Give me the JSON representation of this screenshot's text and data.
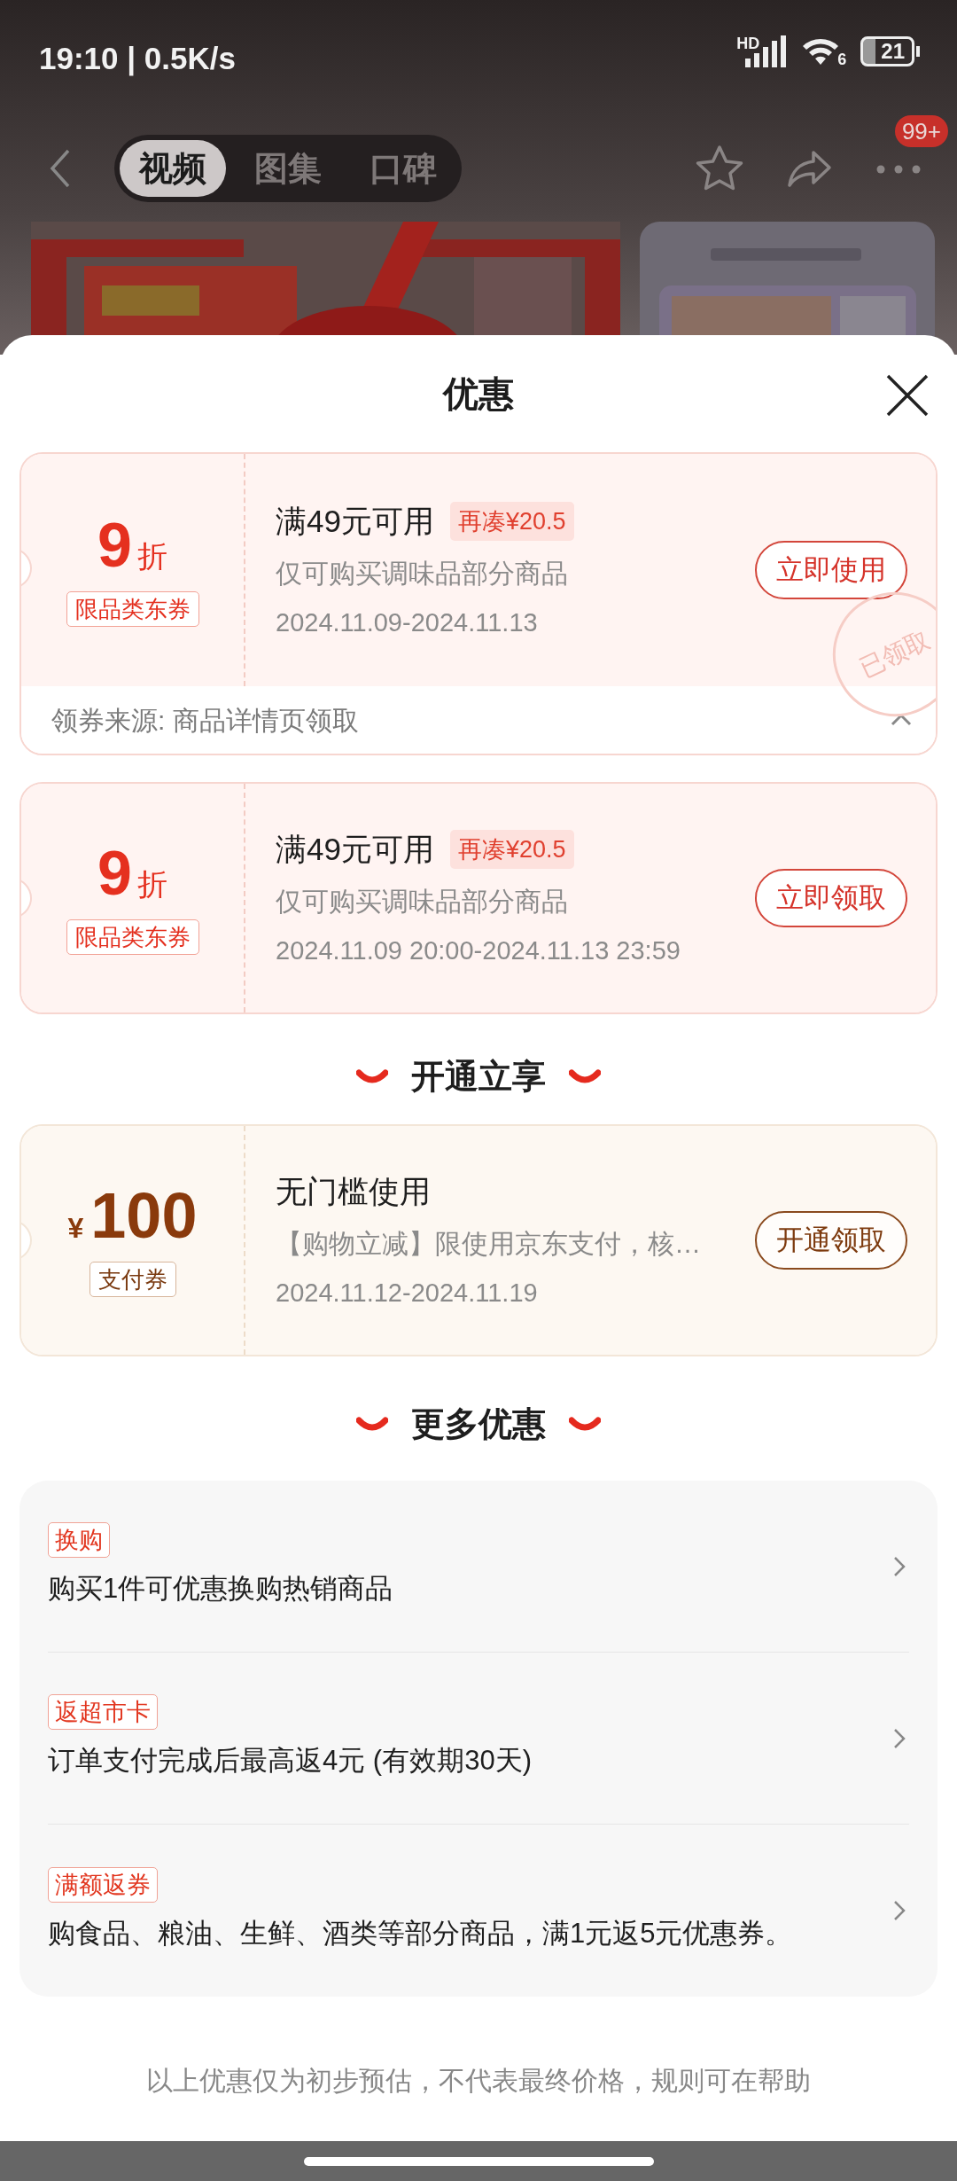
{
  "status_bar": {
    "time": "19:10 | 0.5K/s",
    "network": "HD",
    "wifi_badge": "6",
    "battery": "21"
  },
  "top_nav": {
    "tabs": [
      {
        "label": "视频",
        "selected": true
      },
      {
        "label": "图集",
        "selected": false
      },
      {
        "label": "口碑",
        "selected": false
      }
    ],
    "badge": "99+"
  },
  "sheet": {
    "title": "优惠",
    "coupons": [
      {
        "kind": "category",
        "value": "9",
        "unit": "折",
        "tag": "限品类东券",
        "condition": "满49元可用",
        "extra": "再凑¥20.5",
        "desc": "仅可购买调味品部分商品",
        "date": "2024.11.09-2024.11.13",
        "button": "立即使用",
        "stamp": "已领取",
        "source": "领券来源: 商品详情页领取",
        "expanded": true
      },
      {
        "kind": "category",
        "value": "9",
        "unit": "折",
        "tag": "限品类东券",
        "condition": "满49元可用",
        "extra": "再凑¥20.5",
        "desc": "仅可购买调味品部分商品",
        "date": "2024.11.09 20:00-2024.11.13 23:59",
        "button": "立即领取"
      }
    ],
    "member_section": {
      "title": "开通立享",
      "coupons": [
        {
          "kind": "payment",
          "currency": "¥",
          "value": "100",
          "tag": "支付券",
          "condition": "无门槛使用",
          "desc": "【购物立减】限使用京东支付，核…",
          "date": "2024.11.12-2024.11.19",
          "button": "开通领取"
        }
      ]
    },
    "more_section": {
      "title": "更多优惠",
      "items": [
        {
          "tag": "换购",
          "text": "购买1件可优惠换购热销商品"
        },
        {
          "tag": "返超市卡",
          "text": "订单支付完成后最高返4元 (有效期30天)"
        },
        {
          "tag": "满额返券",
          "text": "购食品、粮油、生鲜、酒类等部分商品，满1元返5元优惠券。"
        }
      ]
    },
    "footer_note": "以上优惠仅为初步预估，不代表最终价格，规则可在帮助"
  }
}
